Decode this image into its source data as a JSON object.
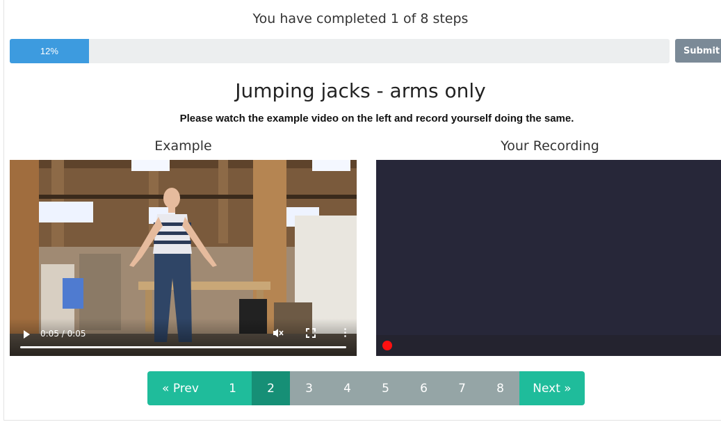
{
  "progress": {
    "title": "You have completed 1 of 8 steps",
    "percent": 12,
    "percent_label": "12%",
    "fill_color": "#3d9bdf"
  },
  "submit_label": "Submit",
  "exercise": {
    "title": "Jumping jacks - arms only",
    "instructions": "Please watch the example video on the left and record yourself doing the same."
  },
  "example_panel": {
    "heading": "Example",
    "time": "0:05 / 0:05",
    "icons": [
      "play-icon",
      "mute-icon",
      "fullscreen-icon",
      "more-vertical-icon"
    ]
  },
  "recording_panel": {
    "heading": "Your Recording",
    "record_indicator_color": "#ff1010",
    "background_color": "#272739"
  },
  "pagination": {
    "prev_label": "« Prev",
    "next_label": "Next »",
    "pages": [
      "1",
      "2",
      "3",
      "4",
      "5",
      "6",
      "7",
      "8"
    ],
    "current_page": 2,
    "accent_color": "#1fbc9b",
    "inactive_color": "#95a5a6"
  }
}
